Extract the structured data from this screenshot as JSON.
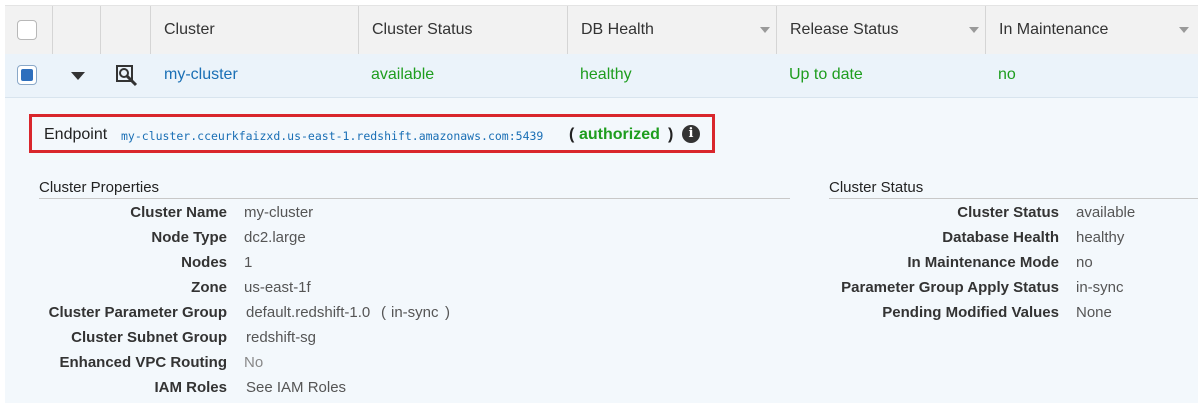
{
  "table": {
    "columns": [
      "Cluster",
      "Cluster Status",
      "DB Health",
      "Release Status",
      "In Maintenance"
    ],
    "row": {
      "cluster": "my-cluster",
      "cluster_status": "available",
      "db_health": "healthy",
      "release_status": "Up to date",
      "in_maintenance": "no"
    }
  },
  "endpoint": {
    "label": "Endpoint",
    "url": "my-cluster.cceurkfaizxd.us-east-1.redshift.amazonaws.com:5439",
    "open_paren": "(",
    "status": "authorized",
    "close_paren": ")",
    "info_icon": "i"
  },
  "cluster_properties": {
    "title": "Cluster Properties",
    "items": [
      {
        "label": "Cluster Name",
        "value": "my-cluster"
      },
      {
        "label": "Node Type",
        "value": "dc2.large"
      },
      {
        "label": "Nodes",
        "value": "1"
      },
      {
        "label": "Zone",
        "value": "us-east-1f"
      },
      {
        "label": "Cluster Parameter Group",
        "value": "default.redshift-1.0",
        "sync_open": "(",
        "sync": "in-sync",
        "sync_close": ")"
      },
      {
        "label": "Cluster Subnet Group",
        "value": "redshift-sg"
      },
      {
        "label": "Enhanced VPC Routing",
        "value": "No"
      },
      {
        "label": "IAM Roles",
        "value": "See IAM Roles"
      }
    ]
  },
  "cluster_status": {
    "title": "Cluster Status",
    "items": [
      {
        "label": "Cluster Status",
        "value": "available"
      },
      {
        "label": "Database Health",
        "value": "healthy"
      },
      {
        "label": "In Maintenance Mode",
        "value": "no"
      },
      {
        "label": "Parameter Group Apply Status",
        "value": "in-sync"
      },
      {
        "label": "Pending Modified Values",
        "value": "None"
      }
    ]
  },
  "colors": {
    "link": "#1a6fb5",
    "status_green": "#1e9d1e",
    "highlight_border": "#d9262c",
    "selected_row": "#ebf3fa"
  },
  "icons": {
    "select_all": "checkbox-icon",
    "expand": "caret-down-icon",
    "details": "magnifier-icon",
    "info": "info-icon"
  }
}
